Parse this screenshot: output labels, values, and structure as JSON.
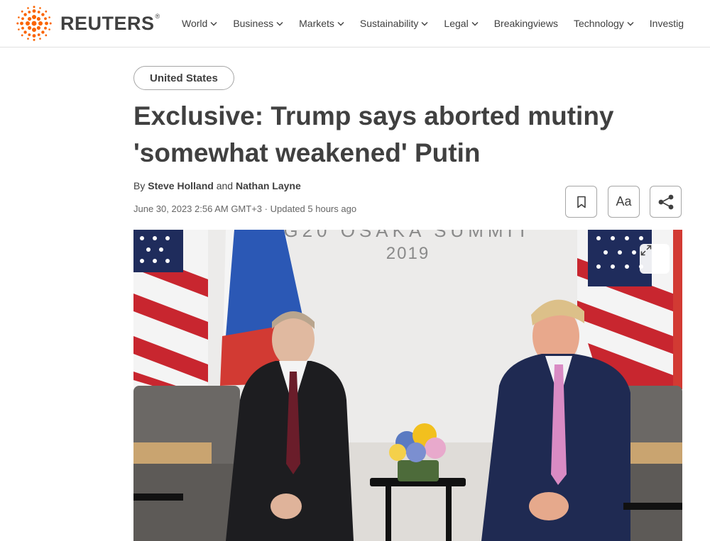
{
  "brand": {
    "name": "REUTERS",
    "mark": "®",
    "accent": "#fa6400"
  },
  "nav": [
    {
      "label": "World",
      "has_menu": true
    },
    {
      "label": "Business",
      "has_menu": true
    },
    {
      "label": "Markets",
      "has_menu": true
    },
    {
      "label": "Sustainability",
      "has_menu": true
    },
    {
      "label": "Legal",
      "has_menu": true
    },
    {
      "label": "Breakingviews",
      "has_menu": false
    },
    {
      "label": "Technology",
      "has_menu": true
    },
    {
      "label": "Investig",
      "has_menu": false
    }
  ],
  "article": {
    "section": "United States",
    "headline_line1": "Exclusive: Trump says aborted mutiny",
    "headline_line2": "'somewhat weakened' Putin",
    "byline_prefix": "By",
    "author1": "Steve Holland",
    "byline_joiner": "and",
    "author2": "Nathan Layne",
    "date": "June 30, 2023 2:56 AM GMT+3",
    "separator": "·",
    "updated": "Updated 5 hours ago"
  },
  "tools": {
    "bookmark_icon": "bookmark-icon",
    "text_size_label": "Aa",
    "share_icon": "share-icon"
  },
  "photo": {
    "backdrop_line1": "G20 OSAKA SUMMIT",
    "backdrop_line2": "2019",
    "expand_icon": "expand-icon"
  }
}
